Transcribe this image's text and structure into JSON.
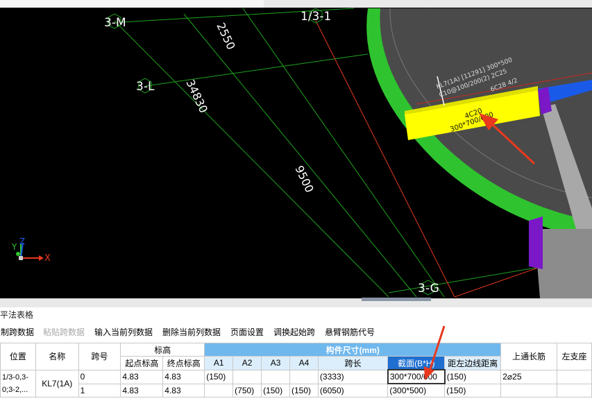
{
  "viewport": {
    "axis_labels": [
      "3-M",
      "3-L",
      "1/3-1",
      "3-G"
    ],
    "dimensions": [
      "2550",
      "34830",
      "9500"
    ],
    "beam_annotation": {
      "line1": "KL7(1A) [11291] 300*500",
      "line2": "C10@100/200(2) 2C25",
      "line3": "6C28 4/2",
      "span_rebar": "4C20",
      "span_section": "300*700/600"
    },
    "coord_axes": {
      "x": "X",
      "y": "Y",
      "z": "Z"
    },
    "colors": {
      "background": "#000000",
      "slab": "#4a4a4a",
      "ring_beam": "#2fc42f",
      "highlight_beam": "#ffff00",
      "arrow": "#e8391e",
      "support": "#7a18c8",
      "axis_grid": "#1ea41e"
    }
  },
  "panel": {
    "title": "梁平法表格",
    "toolbar": [
      "复制跨数据",
      "粘贴跨数据",
      "输入当前列数据",
      "删除当前列数据",
      "页面设置",
      "调换起始跨",
      "悬臂钢筋代号"
    ],
    "toolbar_disabled": [
      false,
      true,
      false,
      false,
      false,
      false,
      false
    ]
  },
  "table": {
    "headers": {
      "position": "位置",
      "name": "名称",
      "span_no": "跨号",
      "elevation_group": "标高",
      "start_elev": "起点标高",
      "end_elev": "终点标高",
      "dimension_group": "构件尺寸(mm)",
      "a1": "A1",
      "a2": "A2",
      "a3": "A3",
      "a4": "A4",
      "span_length": "跨长",
      "section": "截面(B*H)",
      "offset": "距左边线距离",
      "top_through_rebar": "上通长筋",
      "left_support": "左支座"
    },
    "position_value": "1/3-0,3-0;3-2,...",
    "name_value": "KL7(1A)",
    "rows": [
      {
        "span": "0",
        "start": "4.83",
        "end": "4.83",
        "a1": "(150)",
        "a2": "",
        "a3": "",
        "a4": "",
        "length": "(3333)",
        "section": "300*700/600",
        "offset": "(150)",
        "top": "2⌀25"
      },
      {
        "span": "1",
        "start": "4.83",
        "end": "4.83",
        "a1": "",
        "a2": "(750)",
        "a3": "(150)",
        "a4": "(150)",
        "length": "(6050)",
        "section": "(300*500)",
        "offset": "(150)",
        "top": ""
      }
    ]
  }
}
